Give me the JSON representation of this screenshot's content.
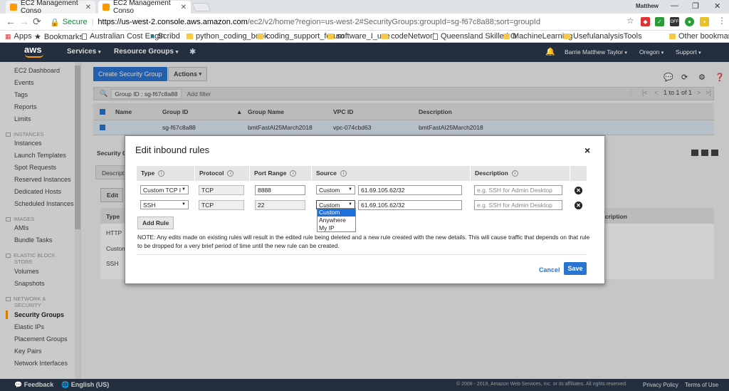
{
  "browser": {
    "tabs": [
      {
        "title": "EC2 Management Conso"
      },
      {
        "title": "EC2 Management Conso"
      }
    ],
    "profile": "Matthew",
    "url": {
      "secure_label": "Secure",
      "host": "https://us-west-2.console.aws.amazon.com",
      "path": "/ec2/v2/home?region=us-west-2#SecurityGroups:groupId=sg-f67c8a88;sort=groupId"
    },
    "bookmarks": [
      "Apps",
      "Bookmarks",
      "Australian Cost Engin",
      "Scribd",
      "python_coding_book",
      "coding_support_forum",
      "software_I_use",
      "codeNetwork",
      "Queensland Skilled O",
      "MachineLearning",
      "UsefulanalysisTools",
      "Other bookmarks"
    ]
  },
  "aws_header": {
    "logo": "aws",
    "services": "Services",
    "resource_groups": "Resource Groups",
    "user": "Barrie Matthew Taylor",
    "region": "Oregon",
    "support": "Support"
  },
  "sidebar": {
    "top": [
      "EC2 Dashboard",
      "Events",
      "Tags",
      "Reports",
      "Limits"
    ],
    "instances_head": "INSTANCES",
    "instances": [
      "Instances",
      "Launch Templates",
      "Spot Requests",
      "Reserved Instances",
      "Dedicated Hosts",
      "Scheduled Instances"
    ],
    "images_head": "IMAGES",
    "images": [
      "AMIs",
      "Bundle Tasks"
    ],
    "ebs_head_1": "ELASTIC BLOCK",
    "ebs_head_2": "STORE",
    "ebs": [
      "Volumes",
      "Snapshots"
    ],
    "net_head_1": "NETWORK &",
    "net_head_2": "SECURITY",
    "net": [
      "Security Groups",
      "Elastic IPs",
      "Placement Groups",
      "Key Pairs",
      "Network Interfaces"
    ]
  },
  "main": {
    "create_button": "Create Security Group",
    "actions_button": "Actions",
    "filter_chip_key": "Group ID :",
    "filter_chip_value": "sg-f67c8a88",
    "filter_placeholder": "Add filter",
    "pager_text": "1 to 1 of 1",
    "columns": [
      "Name",
      "Group ID",
      "Group Name",
      "VPC ID",
      "Description"
    ],
    "row": {
      "name": "",
      "group_id": "sg-f67c8a88",
      "group_name": "bmtFastAI25March2018",
      "vpc_id": "vpc-074cbd63",
      "description": "bmtFastAI25March2018"
    },
    "lower_title": "Security G",
    "lower_tab": "Descript",
    "edit_button": "Edit",
    "lower_col_type": "Type",
    "lower_col_desc": "scription",
    "lower_rows": [
      "HTTP",
      "Custom",
      "SSH"
    ]
  },
  "modal": {
    "title": "Edit inbound rules",
    "close": "×",
    "columns": {
      "type": "Type",
      "protocol": "Protocol",
      "port_range": "Port Range",
      "source": "Source",
      "description": "Description"
    },
    "info": "i",
    "rules": [
      {
        "type": "Custom TCP I",
        "protocol": "TCP",
        "port": "8888",
        "source_select": "Custom",
        "source_cidr": "61.69.105.62/32",
        "desc_placeholder": "e.g. SSH for Admin Desktop"
      },
      {
        "type": "SSH",
        "protocol": "TCP",
        "port": "22",
        "source_select": "Custom",
        "source_cidr": "61.69.105.62/32",
        "desc_placeholder": "e.g. SSH for Admin Desktop"
      }
    ],
    "source_options": [
      "Custom",
      "Anywhere",
      "My IP"
    ],
    "add_rule": "Add Rule",
    "note": "NOTE: Any edits made on existing rules will result in the edited rule being deleted and a new rule created with the new details. This will cause traffic that depends on that rule to be dropped for a very brief period of time until the new rule can be created.",
    "cancel": "Cancel",
    "save": "Save"
  },
  "footer": {
    "feedback": "Feedback",
    "language": "English (US)",
    "copyright": "© 2008 - 2018, Amazon Web Services, Inc. or its affiliates. All rights reserved.",
    "privacy": "Privacy Policy",
    "terms": "Terms of Use"
  },
  "colors": {
    "aws_dark": "#232f3e",
    "accent_orange": "#ff9900",
    "primary_blue": "#2a74d2"
  }
}
